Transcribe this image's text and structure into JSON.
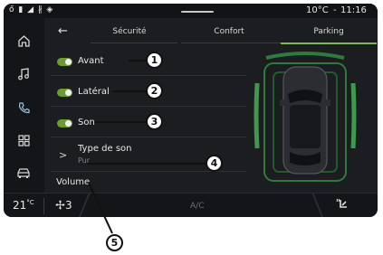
{
  "status": {
    "icons": "ő ▮ ◢ ∦ ◈",
    "temperature": "10°C",
    "separator": "-",
    "time": "11:16"
  },
  "sidebar": {
    "items": [
      "home-icon",
      "music-icon",
      "phone-icon",
      "apps-icon",
      "car-icon"
    ],
    "active_item": "phone-icon"
  },
  "tabs": {
    "back": "←",
    "items": [
      {
        "label": "Sécurité"
      },
      {
        "label": "Confort"
      },
      {
        "label": "Parking"
      }
    ],
    "active": "Parking"
  },
  "settings": {
    "rows": [
      {
        "label": "Avant",
        "toggle_on": true
      },
      {
        "label": "Latéral",
        "toggle_on": true
      },
      {
        "label": "Son",
        "toggle_on": true
      }
    ],
    "sound_type": {
      "chevron": ">",
      "label": "Type de son",
      "value": "Pur"
    },
    "volume_label": "Volume"
  },
  "bottom_bar": {
    "temperature": "21",
    "temp_unit": "°C",
    "fan_level": "3",
    "ac_label": "A/C"
  },
  "callouts": [
    "1",
    "2",
    "3",
    "4",
    "5"
  ],
  "colors": {
    "accent_green": "#7ac043",
    "toggle_green": "#6e9b2d",
    "background": "#1c1d20"
  }
}
